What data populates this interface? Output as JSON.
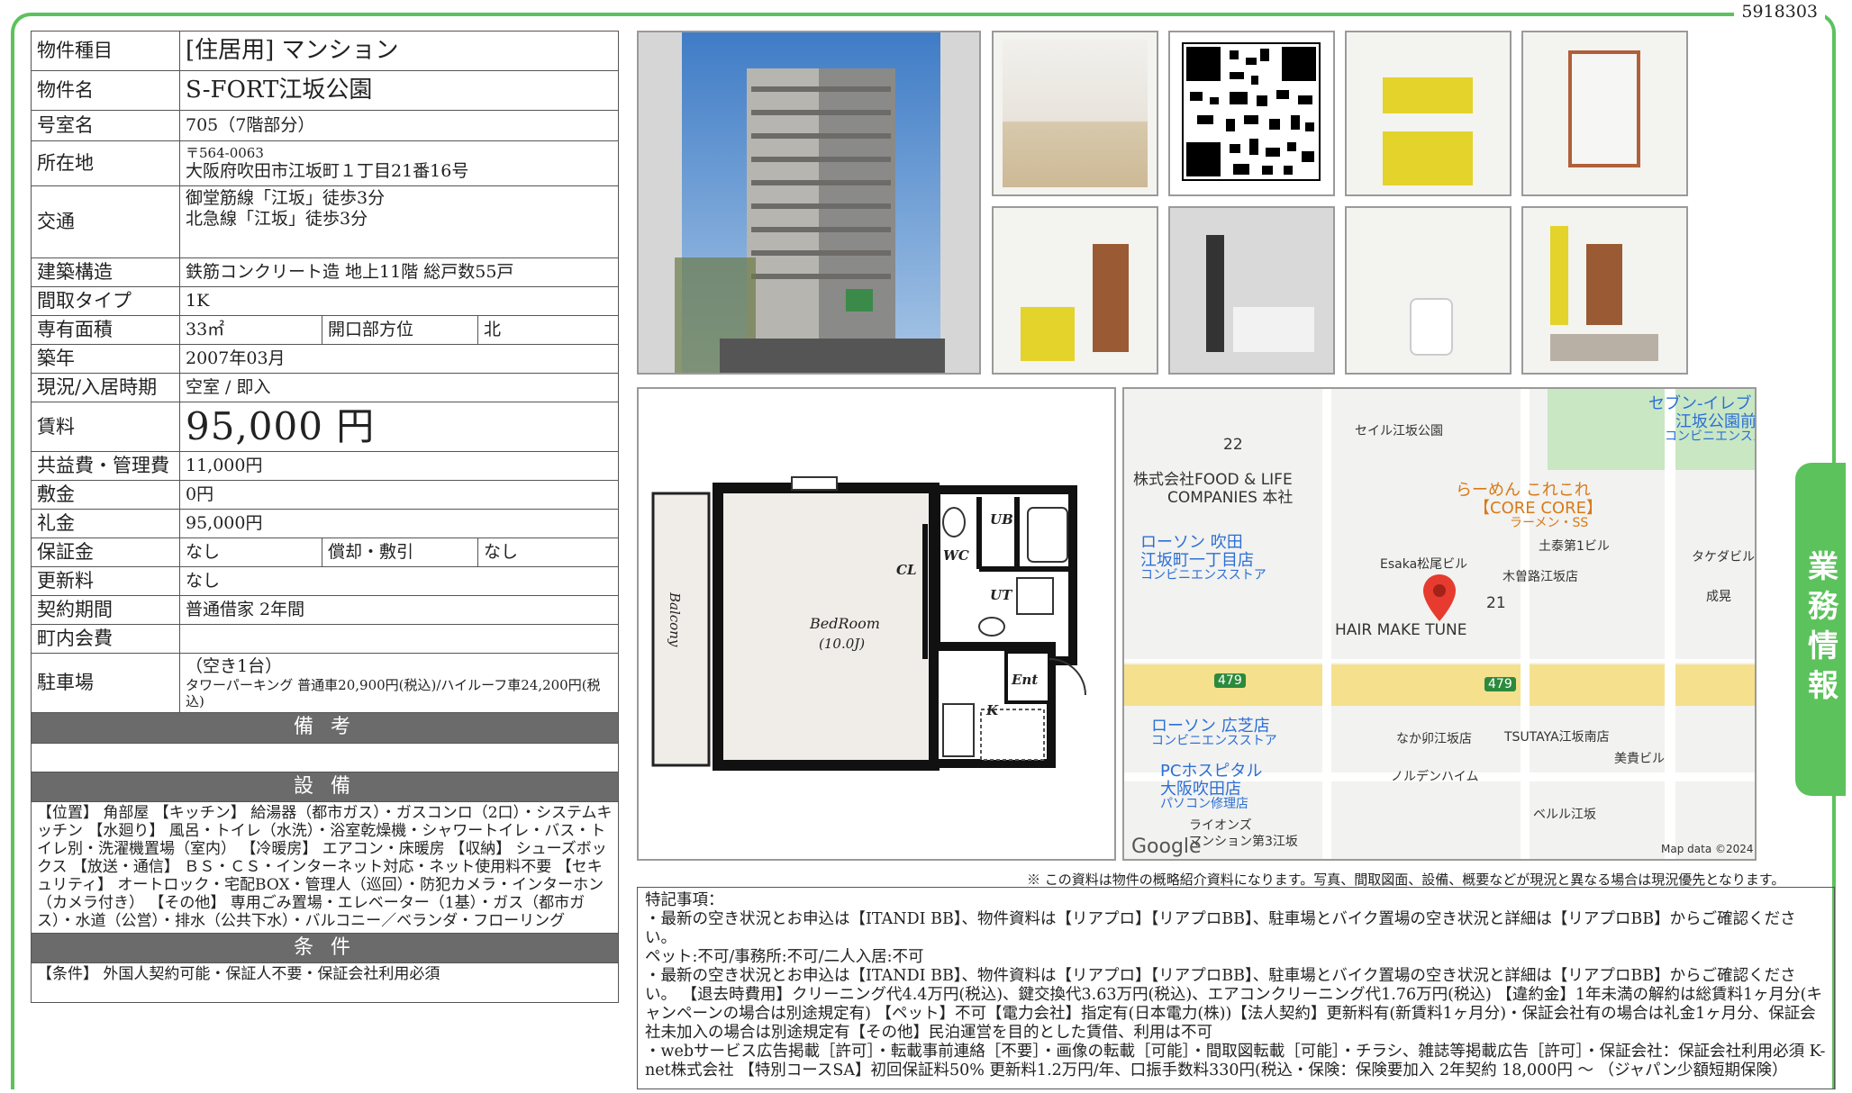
{
  "doc_id": "5918303",
  "table": {
    "type_label": "物件種目",
    "type_value": "[住居用] マンション",
    "name_label": "物件名",
    "name_value": "S-FORT江坂公園",
    "room_label": "号室名",
    "room_value": "705（7階部分）",
    "addr_label": "所在地",
    "addr_zip": "〒564-0063",
    "addr_value": "大阪府吹田市江坂町１丁目21番16号",
    "traffic_label": "交通",
    "traffic_1": "御堂筋線「江坂」徒歩3分",
    "traffic_2": "北急線「江坂」徒歩3分",
    "structure_label": "建築構造",
    "structure_value": "鉄筋コンクリート造 地上11階 総戸数55戸",
    "layout_label": "間取タイプ",
    "layout_value": "1K",
    "area_label": "専有面積",
    "area_value": "33㎡",
    "direction_label": "開口部方位",
    "direction_value": "北",
    "built_label": "築年",
    "built_value": "2007年03月",
    "status_label": "現況/入居時期",
    "status_value": "空室 / 即入",
    "rent_label": "賃料",
    "rent_value": "95,000 円",
    "fee_label": "共益費・管理費",
    "fee_value": "11,000円",
    "deposit_label": "敷金",
    "deposit_value": "0円",
    "keymoney_label": "礼金",
    "keymoney_value": "95,000円",
    "guarantee_label": "保証金",
    "guarantee_value": "なし",
    "amort_label": "償却・敷引",
    "amort_value": "なし",
    "renewal_label": "更新料",
    "renewal_value": "なし",
    "contract_label": "契約期間",
    "contract_value": "普通借家 2年間",
    "town_label": "町内会費",
    "town_value": "",
    "parking_label": "駐車場",
    "parking_1": "（空き1台）",
    "parking_2": "タワーパーキング 普通車20,900円(税込)/ハイルーフ車24,200円(税込)",
    "bikou_header": "備 考",
    "bikou_value": "",
    "setsubi_header": "設 備",
    "setsubi_value": "【位置】 角部屋 【キッチン】 給湯器（都市ガス）・ガスコンロ（2口）・システムキッチン 【水廻り】 風呂・トイレ（水洗）・浴室乾燥機・シャワートイレ・バス・トイレ別・洗濯機置場（室内） 【冷暖房】 エアコン・床暖房 【収納】 シューズボックス 【放送・通信】 ＢＳ・ＣＳ・インターネット対応・ネット使用料不要 【セキュリティ】 オートロック・宅配BOX・管理人（巡回）・防犯カメラ・インターホン（カメラ付き） 【その他】 専用ごみ置場・エレベーター（1基）・ガス（都市ガス）・水道（公営）・排水（公共下水）・バルコニー／ベランダ・フローリング",
    "jouken_header": "条 件",
    "jouken_value": "【条件】 外国人契約可能・保証人不要・保証会社利用必須"
  },
  "floorplan": {
    "balcony": "Balcony",
    "bedroom": "BedRoom",
    "bedroom_size": "(10.0J)",
    "cl": "CL",
    "wc": "WC",
    "ub": "UB",
    "ut": "UT",
    "ent": "Ent",
    "k": "K"
  },
  "map": {
    "labels": {
      "seven": "セブン-イレブ",
      "seven2": "江坂公園前",
      "seven3": "コンビニエンススト",
      "seil": "セイル江坂公園",
      "num22": "22",
      "food": "株式会社FOOD & LIFE",
      "food2": "COMPANIES 本社",
      "ramen": "らーめん これこれ",
      "ramen2": "【CORE CORE】",
      "ramen3": "ラーメン・SS",
      "lawson1": "ローソン 吹田",
      "lawson1b": "江坂町一丁目店",
      "lawson1c": "コンビニエンスストア",
      "doutai": "土泰第1ビル",
      "takeda": "タケダビル",
      "esaka": "Esaka松尾ビル",
      "kiso": "木曽路江坂店",
      "num21": "21",
      "seimi": "成晃",
      "hair": "HAIR MAKE TUNE",
      "r479a": "479",
      "r479b": "479",
      "lawson2": "ローソン 広芝店",
      "lawson2b": "コンビニエンスストア",
      "naka": "なか卯江坂店",
      "tsutaya": "TSUTAYA江坂南店",
      "bikibiru": "美貴ビル",
      "pc": "PCホスピタル",
      "pc2": "大阪吹田店",
      "pc3": "パソコン修理店",
      "norden": "ノルデンハイム",
      "belle": "ベルル江坂",
      "lions": "ライオンズ",
      "lions2": "マンション第3江坂",
      "google": "Google",
      "mapdata": "Map data ©2024"
    }
  },
  "notice": "※ この資料は物件の概略紹介資料になります。写真、間取図面、設備、概要などが現況と異なる場合は現況優先となります。",
  "remarks": {
    "title": "特記事項：",
    "line1": "・最新の空き状況とお申込は【ITANDI BB】、物件資料は【リアプロ】【リアプロBB】、駐車場とバイク置場の空き状況と詳細は【リアプロBB】からご確認ください。",
    "line2": "ペット:不可/事務所:不可/二人入居:不可",
    "line3": "・最新の空き状況とお申込は【ITANDI BB】、物件資料は【リアプロ】【リアプロBB】、駐車場とバイク置場の空き状況と詳細は【リアプロBB】からご確認ください。 【退去時費用】クリーニング代4.4万円(税込)、鍵交換代3.63万円(税込)、エアコンクリーニング代1.76万円(税込) 【違約金】1年未満の解約は総賃料1ヶ月分(キャンペーンの場合は別途規定有) 【ペット】不可【電力会社】指定有(日本電力(株))【法人契約】更新料有(新賃料1ヶ月分)・保証会社有の場合は礼金1ヶ月分、保証会社未加入の場合は別途規定有【その他】民泊運営を目的とした賃借、利用は不可",
    "line4": "・webサービス広告掲載［許可］・転載事前連絡［不要］・画像の転載［可能］・間取図転載［可能］・チラシ、雑誌等掲載広告［許可］・保証会社：保証会社利用必須 K-net株式会社 【特別コースSA】初回保証料50% 更新料1.2万円/年、口振手数料330円(税込・保険：保険要加入 2年契約 18,000円 〜 （ジャパン少額短期保険）"
  },
  "side_tab": "業務情報"
}
